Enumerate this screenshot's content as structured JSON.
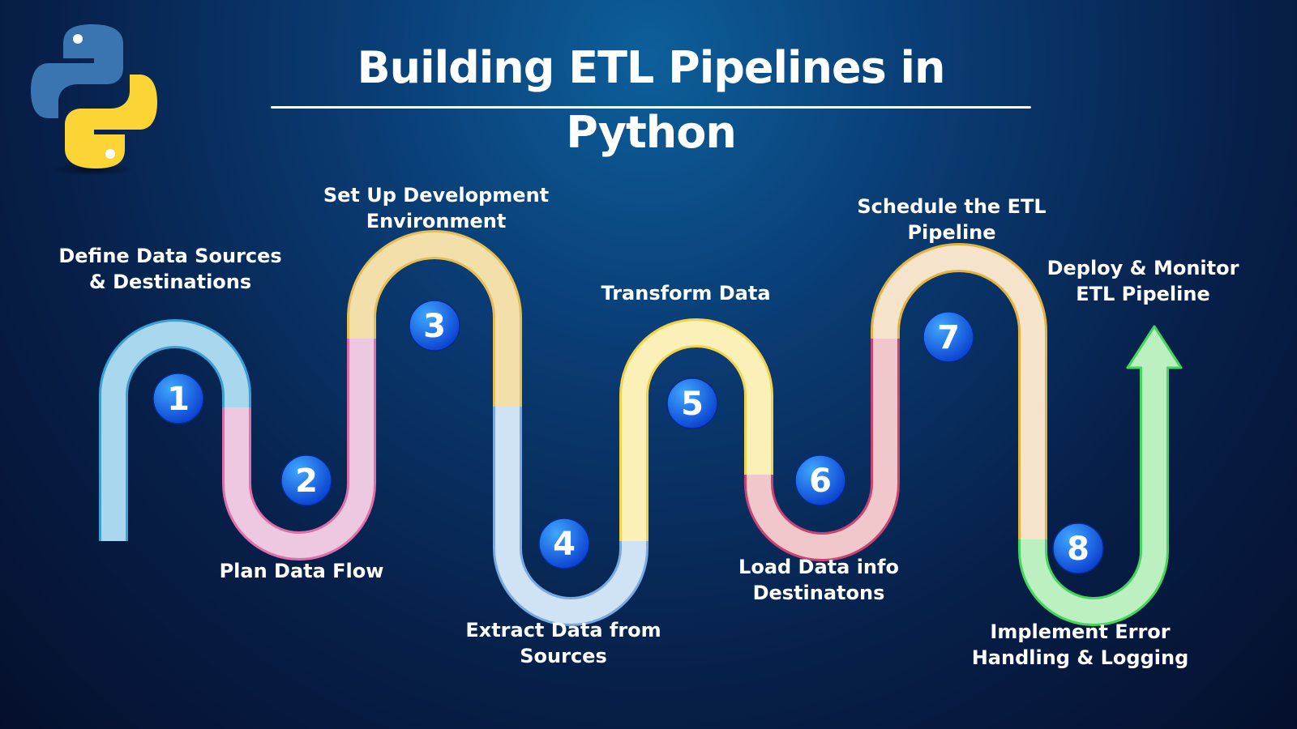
{
  "title": "Building ETL Pipelines in Python",
  "logo": {
    "name": "python-logo",
    "colors": {
      "blue": "#3b75b1",
      "yellow": "#fdd435"
    }
  },
  "steps": [
    {
      "number": "1",
      "label": "Define Data Sources\n& Destinations",
      "color": "#a9d7ee",
      "stroke": "#3d9fd4"
    },
    {
      "number": "2",
      "label": "Plan Data Flow",
      "color": "#ecc9e0",
      "stroke": "#de6fa9"
    },
    {
      "number": "3",
      "label": "Set Up Development\nEnvironment",
      "color": "#f3dfaa",
      "stroke": "#e7bd55"
    },
    {
      "number": "4",
      "label": "Extract Data from\nSources",
      "color": "#cfe3f5",
      "stroke": "#7aa8e0"
    },
    {
      "number": "5",
      "label": "Transform Data",
      "color": "#fbf1b8",
      "stroke": "#f2d34a"
    },
    {
      "number": "6",
      "label": "Load Data info\nDestinatons",
      "color": "#f0c8cb",
      "stroke": "#c94373"
    },
    {
      "number": "7",
      "label": "Schedule the ETL\nPipeline",
      "color": "#f5e3cc",
      "stroke": "#e4b23f"
    },
    {
      "number": "8",
      "label": "Implement Error\nHandling & Logging",
      "color": "#bdf0c0",
      "stroke": "#45d65e"
    }
  ],
  "final_step": {
    "label": "Deploy & Monitor\nETL Pipeline"
  },
  "colors": {
    "badge_light": "#3fa7ff",
    "badge_dark": "#0a3fd0"
  }
}
